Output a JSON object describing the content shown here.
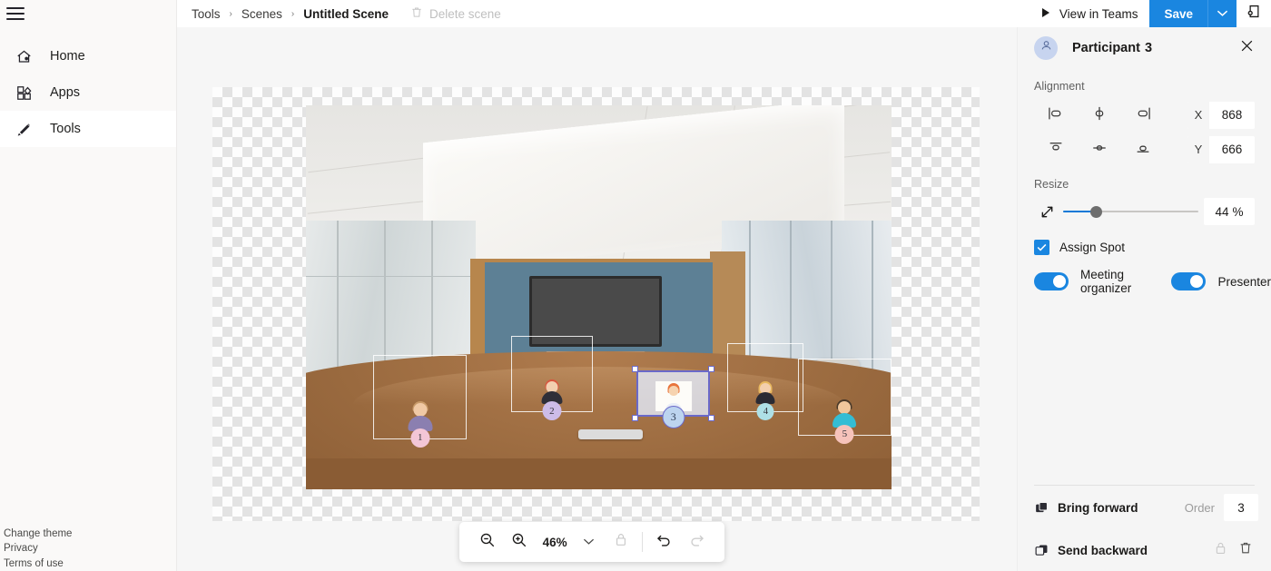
{
  "rail": {
    "menu_icon": "hamburger-icon",
    "items": [
      {
        "label": "Home",
        "icon": "home-icon",
        "active": false
      },
      {
        "label": "Apps",
        "icon": "apps-icon",
        "active": false
      },
      {
        "label": "Tools",
        "icon": "pencil-icon",
        "active": true
      }
    ],
    "footer": [
      {
        "label": "Change theme"
      },
      {
        "label": "Privacy"
      },
      {
        "label": "Terms of use"
      }
    ]
  },
  "topbar": {
    "breadcrumb": [
      "Tools",
      "Scenes",
      "Untitled Scene"
    ],
    "separator": "›",
    "delete_scene_label": "Delete scene",
    "delete_scene_icon": "trash-icon",
    "view_in_teams_label": "View in Teams",
    "view_in_teams_icon": "play-icon",
    "save_label": "Save",
    "save_caret_icon": "chevron-down-icon",
    "new_scene_icon": "add-scene-icon",
    "save_color": "#1a86e0"
  },
  "canvas": {
    "scene_participants": [
      {
        "number": "1",
        "badge_color": "#f3c6d6",
        "shirt": "#8b7fb0",
        "hair": "#c89a68",
        "skin": "#f0c9a5",
        "selected": false
      },
      {
        "number": "2",
        "badge_color": "#cdbce8",
        "shirt": "#2f2f38",
        "hair": "#d9563f",
        "skin": "#f2cfb0",
        "selected": false
      },
      {
        "number": "3",
        "badge_color": "#bcd4ef",
        "shirt": "#f3efe9",
        "hair": "#e8743c",
        "skin": "#f6d3b0",
        "selected": true
      },
      {
        "number": "4",
        "badge_color": "#aee0e6",
        "shirt": "#2a2a33",
        "hair": "#e8b85e",
        "skin": "#f3cfae",
        "selected": false
      },
      {
        "number": "5",
        "badge_color": "#f6c3bb",
        "shirt": "#34bdd4",
        "hair": "#4a3a2a",
        "skin": "#f1c79c",
        "selected": false
      }
    ]
  },
  "zoombar": {
    "zoom_out_icon": "zoom-out-icon",
    "zoom_in_icon": "zoom-in-icon",
    "zoom_level": "46%",
    "zoom_caret_icon": "chevron-down-icon",
    "lock_icon": "lock-icon",
    "undo_icon": "undo-icon",
    "redo_icon": "redo-icon"
  },
  "panel": {
    "avatar_icon": "person-icon",
    "title": "Participant",
    "title_number": "3",
    "close_icon": "close-icon",
    "alignment_label": "Alignment",
    "align_buttons": [
      "align-left-icon",
      "align-center-horizontal-icon",
      "align-right-icon",
      "align-top-icon",
      "align-center-vertical-icon",
      "align-bottom-icon"
    ],
    "x_label": "X",
    "x_value": "868",
    "y_label": "Y",
    "y_value": "666",
    "resize_label": "Resize",
    "resize_icon": "resize-diagonal-icon",
    "resize_percent": "44",
    "percent_symbol": "%",
    "assign_spot_label": "Assign Spot",
    "assign_spot_checked": true,
    "meeting_organizer_label": "Meeting organizer",
    "meeting_organizer_on": true,
    "presenter_label": "Presenter",
    "presenter_on": true,
    "bring_forward_label": "Bring forward",
    "bring_forward_icon": "bring-forward-icon",
    "send_backward_label": "Send backward",
    "send_backward_icon": "send-backward-icon",
    "order_label": "Order",
    "order_value": "3",
    "lock_icon": "lock-icon",
    "delete_icon": "trash-icon"
  }
}
